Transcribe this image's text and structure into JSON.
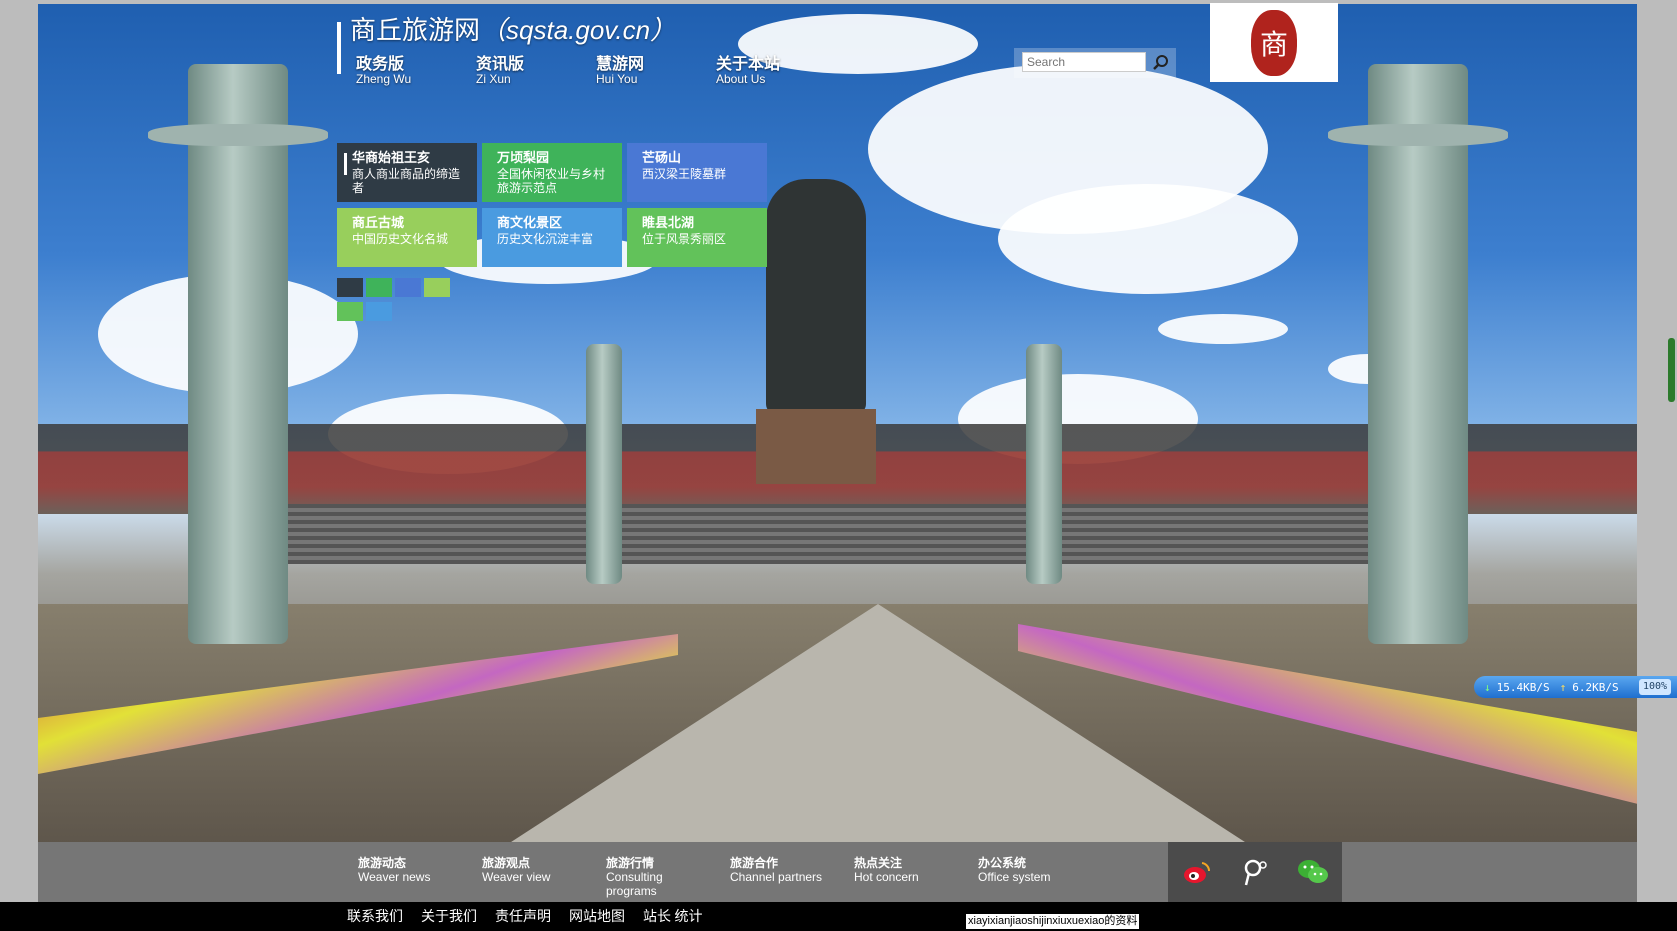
{
  "site": {
    "name": "商丘旅游网",
    "url": "（sqsta.gov.cn）"
  },
  "topnav": [
    {
      "zh": "政务版",
      "en": "Zheng Wu"
    },
    {
      "zh": "资讯版",
      "en": "Zi Xun"
    },
    {
      "zh": "慧游网",
      "en": "Hui You"
    },
    {
      "zh": "关于本站",
      "en": "About Us"
    }
  ],
  "search": {
    "placeholder": "Search"
  },
  "logo": {
    "glyph": "商"
  },
  "tiles": [
    {
      "title": "华商始祖王亥",
      "desc": "商人商业商品的缔造者",
      "color": "#2f3b45"
    },
    {
      "title": "万顷梨园",
      "desc": "全国休闲农业与乡村旅游示范点",
      "color": "#3fb35a"
    },
    {
      "title": "芒砀山",
      "desc": "西汉梁王陵墓群",
      "color": "#4a78d4"
    },
    {
      "title": "商丘古城",
      "desc": "中国历史文化名城",
      "color": "#98cf5c"
    },
    {
      "title": "商文化景区",
      "desc": "历史文化沉淀丰富",
      "color": "#4a9be0"
    },
    {
      "title": "睢县北湖",
      "desc": "位于风景秀丽区",
      "color": "#62c25a"
    }
  ],
  "dots": [
    "#2f3b45",
    "#3fb35a",
    "#4a78d4",
    "#98cf5c",
    "#62c25a",
    "#4a9be0"
  ],
  "speed": {
    "down": "15.4KB/S",
    "up": "6.2KB/S",
    "pct": "100%"
  },
  "footer_nav": [
    {
      "zh": "旅游动态",
      "en": "Weaver news"
    },
    {
      "zh": "旅游观点",
      "en": "Weaver view"
    },
    {
      "zh": "旅游行情",
      "en": "Consulting",
      "en2": "programs"
    },
    {
      "zh": "旅游合作",
      "en": "Channel partners"
    },
    {
      "zh": "热点关注",
      "en": "Hot concern"
    },
    {
      "zh": "办公系统",
      "en": "Office system"
    }
  ],
  "social": [
    {
      "icon": "weibo-icon"
    },
    {
      "icon": "tencent-weibo-icon"
    },
    {
      "icon": "wechat-icon"
    }
  ],
  "bottom_links": [
    "联系我们",
    "关于我们",
    "责任声明",
    "网站地图",
    "站长 统计"
  ],
  "bottom_note": "xiayixianjiaoshijinxiuxuexiao的资料"
}
